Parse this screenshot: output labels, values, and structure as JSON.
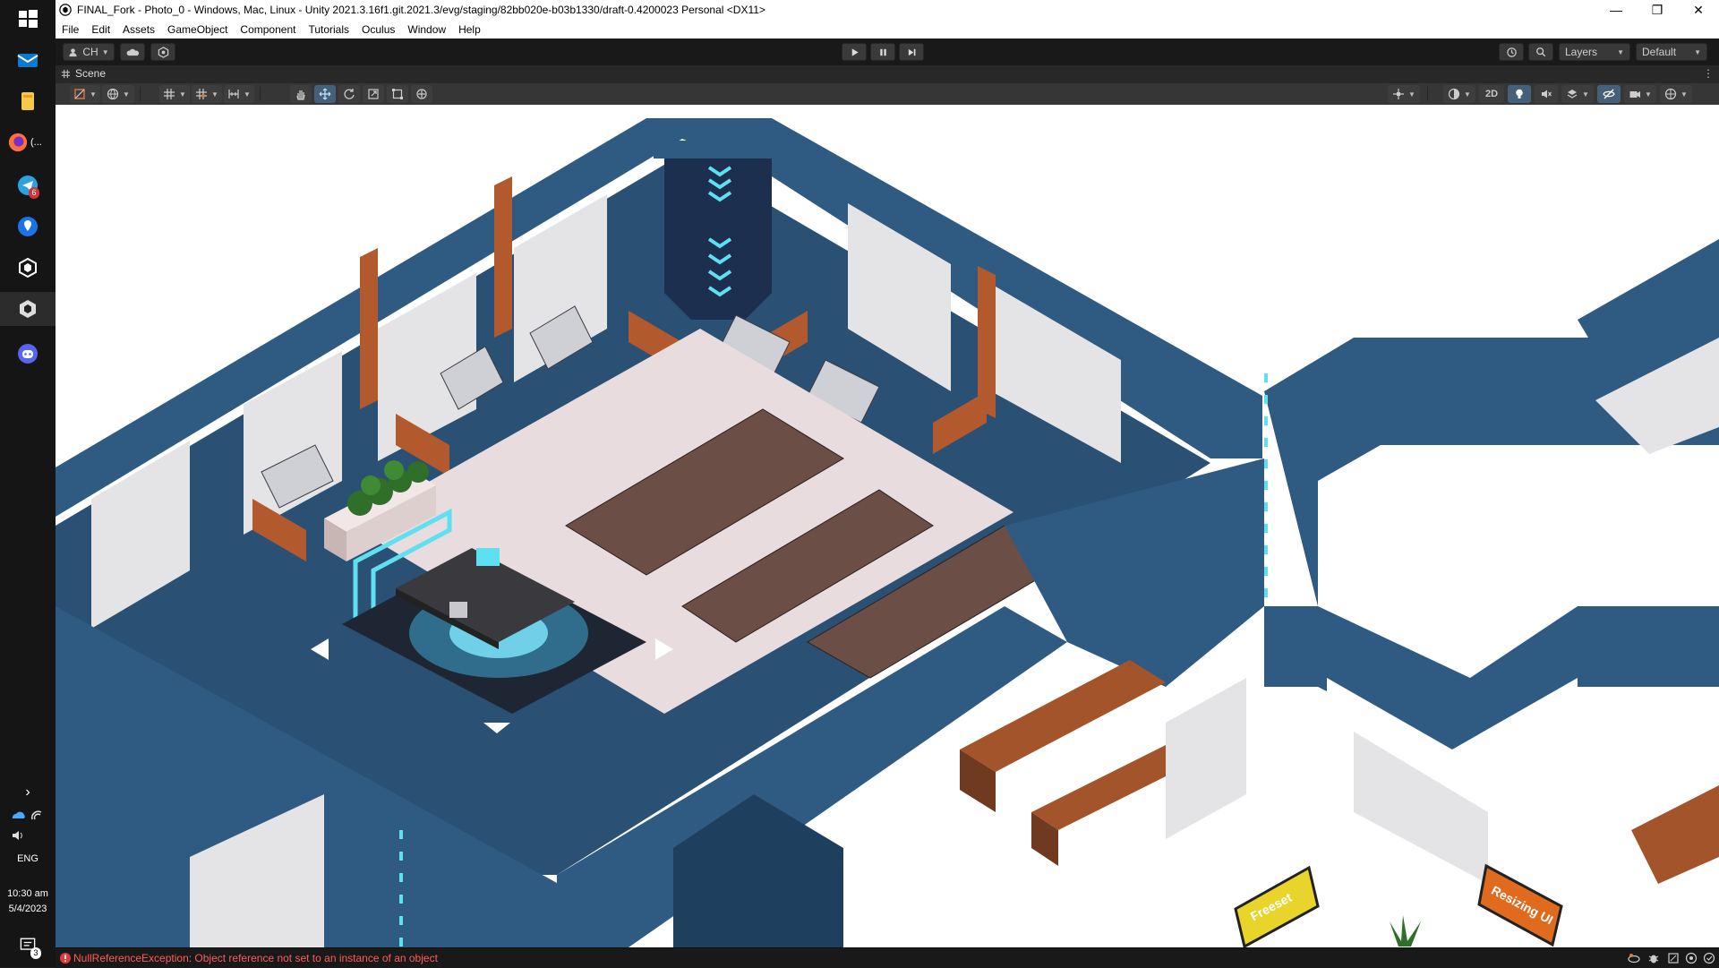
{
  "window": {
    "title": "FINAL_Fork - Photo_0 - Windows, Mac, Linux - Unity 2021.3.16f1.git.2021.3/evg/staging/82bb020e-b03b1330/draft-0.4200023 Personal <DX11>",
    "minimize": "—",
    "maximize": "❐",
    "close": "✕"
  },
  "menu": [
    "File",
    "Edit",
    "Assets",
    "GameObject",
    "Component",
    "Tutorials",
    "Oculus",
    "Window",
    "Help"
  ],
  "toolbar": {
    "account_label": "CH",
    "layers_label": "Layers",
    "layout_label": "Default"
  },
  "scene_tab": {
    "label": "Scene",
    "menu_glyph": "⋮"
  },
  "scene_toolbar": {
    "mode_2d_label": "2D"
  },
  "scene_labels": {
    "freeset_sign": "Freeset",
    "resizing_sign": "Resizing UI"
  },
  "status": {
    "error_message": "NullReferenceException: Object reference not set to an instance of an object"
  },
  "taskbar": {
    "firefox_label": "(...",
    "telegram_badge": "6",
    "language": "ENG",
    "time": "10:30 am",
    "date": "5/4/2023",
    "notification_badge": "3",
    "expand_glyph": "›"
  },
  "colors": {
    "wall_blue": "#2f5b82",
    "wall_dark": "#1f3f5e",
    "floor_light": "#e9dcdf",
    "accent_copper": "#b2592e",
    "glow_cyan": "#5fe0f0",
    "sign_yellow": "#e8d42a",
    "sign_orange": "#e06a1e",
    "error_red": "#ff5b5b"
  }
}
